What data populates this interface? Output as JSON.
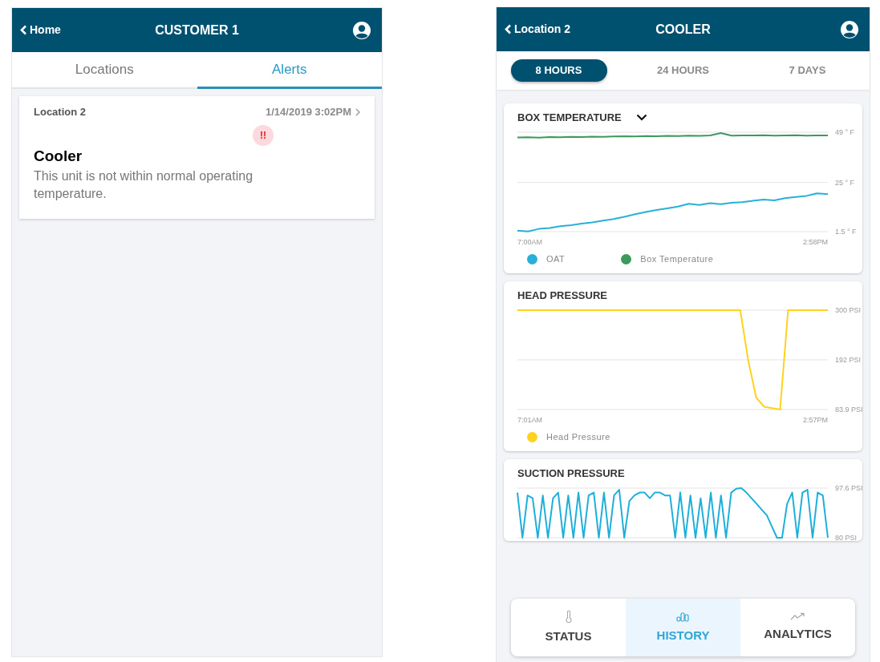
{
  "customer_screen": {
    "header": {
      "back": "Home",
      "title": "CUSTOMER 1"
    },
    "tabs": [
      {
        "label": "Locations",
        "selected": false
      },
      {
        "label": "Alerts",
        "selected": true
      }
    ],
    "alerts": [
      {
        "location": "Location 2",
        "time": "1/14/2019 3:02PM",
        "badge": "!!",
        "unit": "Cooler",
        "message": "This unit is not within normal operating temperature."
      }
    ]
  },
  "unit_screen": {
    "header": {
      "back": "Location 2",
      "title": "COOLER"
    },
    "ranges": [
      {
        "label": "8 HOURS",
        "selected": true
      },
      {
        "label": "24 HOURS",
        "selected": false
      },
      {
        "label": "7 DAYS",
        "selected": false
      }
    ],
    "charts": [
      {
        "title": "BOX TEMPERATURE",
        "dropdown": true,
        "x_start": "7:00AM",
        "x_end": "2:58PM",
        "chart_data": {
          "type": "line",
          "ylim": [
            1.5,
            49
          ],
          "yticks": [
            {
              "value": 49,
              "label": "49 ° F"
            },
            {
              "value": 25,
              "label": "25 ° F"
            },
            {
              "value": 1.5,
              "label": "1.5 ° F"
            }
          ],
          "series": [
            {
              "name": "OAT",
              "color": "#29b0d8",
              "values": [
                2.0,
                1.6,
                2.8,
                3.2,
                4.1,
                4.6,
                5.3,
                5.9,
                6.8,
                7.5,
                8.6,
                9.8,
                10.9,
                11.8,
                12.6,
                13.5,
                14.8,
                14.2,
                15.1,
                14.6,
                15.3,
                15.6,
                16.2,
                16.8,
                16.4,
                17.5,
                18.1,
                18.6,
                19.8,
                19.4
              ]
            },
            {
              "name": "Box Temperature",
              "color": "#3c9a5a",
              "values": [
                46.5,
                46.6,
                46.4,
                46.7,
                46.6,
                46.8,
                46.7,
                46.9,
                46.8,
                47.0,
                47.1,
                47.0,
                47.2,
                47.1,
                47.3,
                47.2,
                47.4,
                47.3,
                47.5,
                48.6,
                47.4,
                47.5,
                47.5,
                47.6,
                47.4,
                47.5,
                47.6,
                47.4,
                47.5,
                47.5
              ]
            }
          ]
        }
      },
      {
        "title": "HEAD PRESSURE",
        "dropdown": false,
        "x_start": "7:01AM",
        "x_end": "2:57PM",
        "chart_data": {
          "type": "line",
          "ylim": [
            83.9,
            300
          ],
          "yticks": [
            {
              "value": 300,
              "label": "300 PSI"
            },
            {
              "value": 192,
              "label": "192 PSI"
            },
            {
              "value": 83.9,
              "label": "83.9 PSI"
            }
          ],
          "series": [
            {
              "name": "Head Pressure",
              "color": "#ffd21f",
              "values": [
                300,
                300,
                300,
                300,
                300,
                300,
                300,
                300,
                300,
                300,
                300,
                300,
                300,
                300,
                300,
                300,
                300,
                300,
                300,
                300,
                300,
                300,
                300,
                300,
                300,
                300,
                300,
                300,
                300,
                190,
                110,
                90,
                87,
                84,
                300,
                300,
                300,
                300,
                300,
                300
              ]
            }
          ]
        }
      },
      {
        "title": "SUCTION PRESSURE",
        "dropdown": false,
        "chart_data": {
          "type": "line",
          "ylim": [
            80,
            97.6
          ],
          "yticks": [
            {
              "value": 97.6,
              "label": "97.6 PSI"
            },
            {
              "value": 80,
              "label": "80 PSI"
            }
          ],
          "series": [
            {
              "color": "#1fafdb",
              "values": [
                96,
                80,
                95,
                94,
                80,
                95,
                80,
                94,
                96,
                80,
                95,
                80,
                96,
                80,
                95,
                96,
                80,
                96,
                80,
                95,
                97,
                80,
                93,
                95,
                96,
                96,
                94,
                96,
                96,
                95,
                95,
                80,
                96,
                80,
                95,
                80,
                94,
                80,
                96,
                80,
                95,
                80,
                96,
                97.4,
                97.6,
                96,
                94,
                92,
                90,
                88,
                84,
                80,
                80,
                92,
                96,
                80,
                96,
                97,
                80,
                96,
                95,
                80
              ]
            }
          ]
        }
      }
    ],
    "bottom_nav": [
      {
        "label": "STATUS",
        "kind": "thermometer",
        "selected": false
      },
      {
        "label": "HISTORY",
        "kind": "bars",
        "selected": true
      },
      {
        "label": "ANALYTICS",
        "kind": "trend",
        "selected": false
      }
    ]
  }
}
